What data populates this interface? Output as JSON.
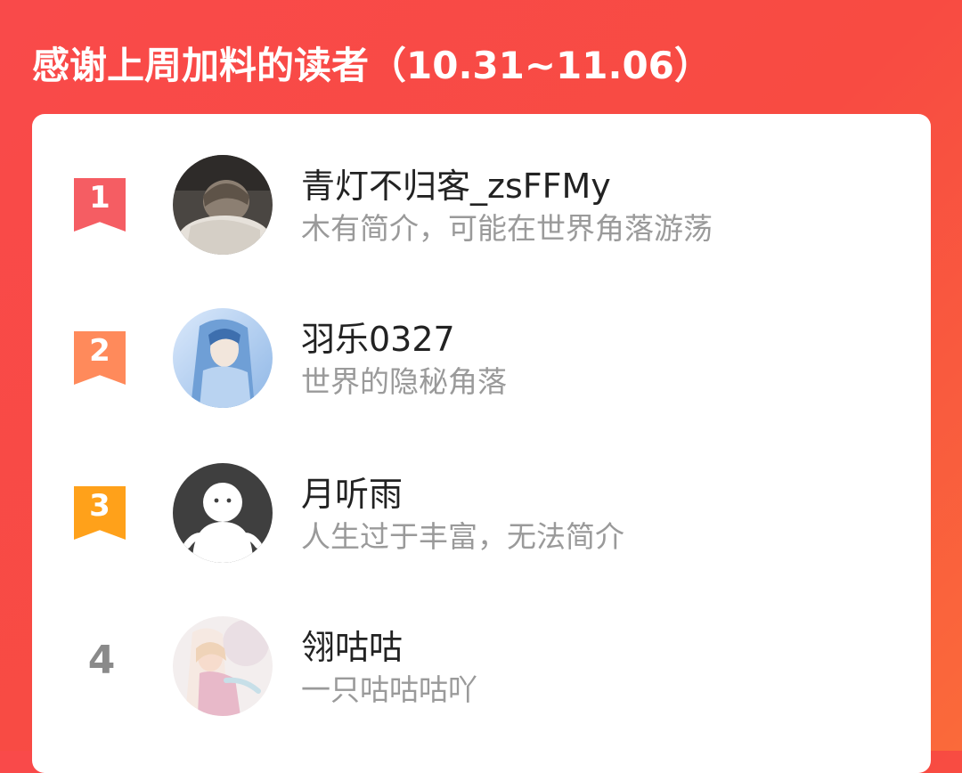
{
  "header": {
    "title": "感谢上周加料的读者（10.31~11.06）"
  },
  "readers": [
    {
      "rank": "1",
      "name": "青灯不归客_zsFFMy",
      "bio": "木有简介，可能在世界角落游荡",
      "badge_color": "#f55d63",
      "avatar": "avatar-sleeping-boy"
    },
    {
      "rank": "2",
      "name": "羽乐0327",
      "bio": "世界的隐秘角落",
      "badge_color": "#ff8a5b",
      "avatar": "avatar-blue-hair-character"
    },
    {
      "rank": "3",
      "name": "月听雨",
      "bio": "人生过于丰富，无法简介",
      "badge_color": "#ffa11a",
      "avatar": "avatar-default-silhouette"
    },
    {
      "rank": "4",
      "name": "翎咕咕",
      "bio": "一只咕咕咕吖",
      "badge_color": "",
      "avatar": "avatar-anime-girl"
    }
  ]
}
